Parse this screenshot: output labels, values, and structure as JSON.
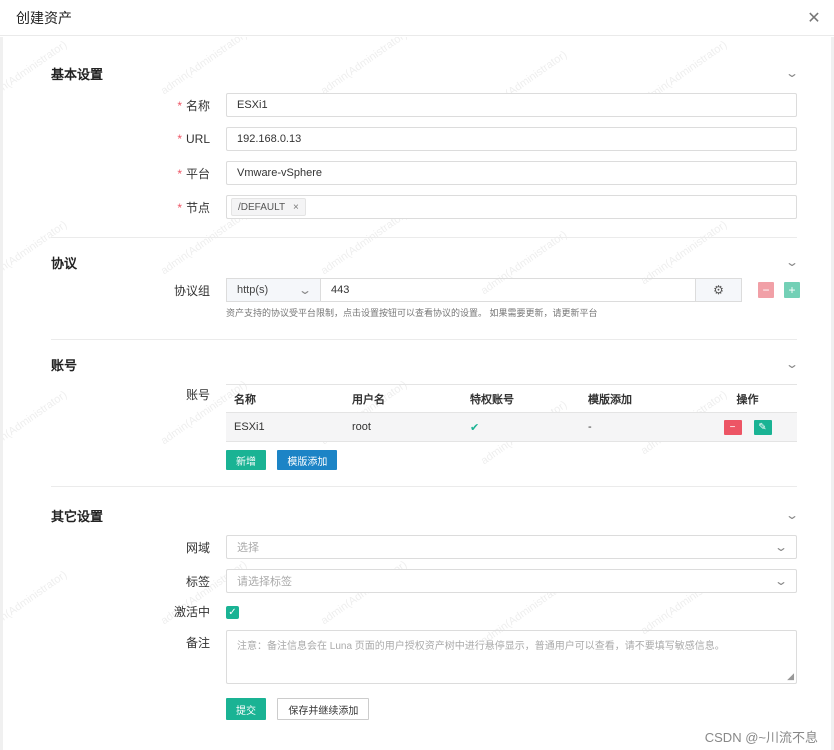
{
  "dialog": {
    "title": "创建资产",
    "close_icon": "close-icon"
  },
  "sections": {
    "basic": {
      "title": "基本设置",
      "fields": {
        "name": {
          "label": "名称",
          "value": "ESXi1"
        },
        "url": {
          "label": "URL",
          "value": "192.168.0.13"
        },
        "platform": {
          "label": "平台",
          "value": "Vmware-vSphere"
        },
        "node": {
          "label": "节点",
          "tag": "/DEFAULT",
          "tag_remove": "×"
        }
      }
    },
    "protocol": {
      "title": "协议",
      "label": "协议组",
      "protocol": "http(s)",
      "port": "443",
      "help": "资产支持的协议受平台限制，点击设置按钮可以查看协议的设置。 如果需要更新，请更新平台",
      "remove": "−",
      "add": "+"
    },
    "accounts": {
      "title": "账号",
      "label": "账号",
      "columns": [
        "名称",
        "用户名",
        "特权账号",
        "模版添加",
        "操作"
      ],
      "rows": [
        {
          "name": "ESXi1",
          "username": "root",
          "privileged": "✔",
          "template": "-"
        }
      ],
      "add_button": "新增",
      "template_button": "模版添加"
    },
    "other": {
      "title": "其它设置",
      "domain": {
        "label": "网域",
        "placeholder": "选择"
      },
      "labels": {
        "label": "标签",
        "placeholder": "请选择标签"
      },
      "active": {
        "label": "激活中",
        "checked": true
      },
      "comment": {
        "label": "备注",
        "placeholder": "注意：备注信息会在 Luna 页面的用户授权资产树中进行悬停显示，普通用户可以查看，请不要填写敏感信息。"
      }
    }
  },
  "actions": {
    "submit": "提交",
    "save_continue": "保存并继续添加"
  },
  "watermark": "admin(Administrator)",
  "footer": "CSDN @~川流不息",
  "colors": {
    "primary": "#1ab394",
    "blue": "#1c84c6",
    "danger": "#ed5565",
    "required": "#ed5565"
  }
}
